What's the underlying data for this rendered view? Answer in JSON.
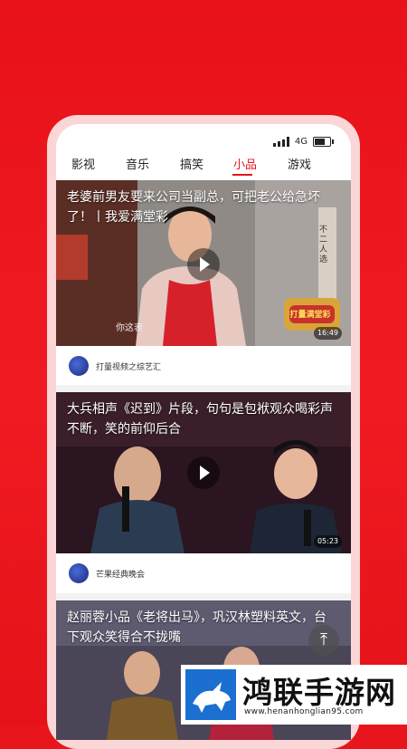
{
  "status_bar": {
    "network": "4G"
  },
  "tabs": [
    "影视",
    "音乐",
    "搞笑",
    "小品",
    "游戏"
  ],
  "active_tab": "小品",
  "videos": [
    {
      "title": "老婆前男友要来公司当副总，可把老公给急坏了！丨我爱满堂彩",
      "duration": "16:49",
      "channel": "打量视频之综艺汇",
      "subtitle_snippet": "你这表",
      "sign_text": "不二人选",
      "logo_text": "打量满堂彩"
    },
    {
      "title": "大兵相声《迟到》片段，句句是包袱观众喝彩声不断，笑的前仰后合",
      "duration": "05:23",
      "channel": "芒果经典晚会"
    },
    {
      "title": "赵丽蓉小品《老将出马》，巩汉林塑料英文，台下观众笑得合不拢嘴"
    }
  ],
  "back_to_top_icon": "arrow-up-to-top-icon",
  "brand": {
    "name": "鸿联手游网",
    "url": "www.henanhonglian95.com",
    "logo_icon": "bull-logo-icon"
  },
  "colors": {
    "accent": "#e8161c",
    "background": "#e8161c"
  }
}
